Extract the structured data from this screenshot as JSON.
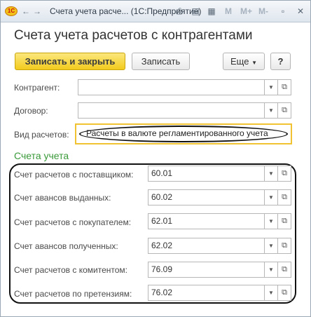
{
  "window": {
    "title": "Счета учета расче... (1С:Предприятие)",
    "logo_text": "1С",
    "toolbar_m_labels": [
      "M",
      "M+",
      "M-"
    ]
  },
  "form": {
    "title": "Счета учета расчетов с контрагентами",
    "save_close_label": "Записать и закрыть",
    "save_label": "Записать",
    "more_label": "Еще",
    "help_label": "?"
  },
  "fields": {
    "counterparty": {
      "label": "Контрагент:",
      "value": ""
    },
    "contract": {
      "label": "Договор:",
      "value": ""
    },
    "calc_type": {
      "label": "Вид расчетов:",
      "value": "Расчеты в валюте регламентированного учета"
    }
  },
  "accounts": {
    "section_title": "Счета учета",
    "rows": [
      {
        "label": "Счет расчетов с поставщиком:",
        "value": "60.01"
      },
      {
        "label": "Счет авансов выданных:",
        "value": "60.02"
      },
      {
        "label": "Счет расчетов с покупателем:",
        "value": "62.01"
      },
      {
        "label": "Счет авансов полученных:",
        "value": "62.02"
      },
      {
        "label": "Счет расчетов с комитентом:",
        "value": "76.09"
      },
      {
        "label": "Счет расчетов по претензиям:",
        "value": "76.02"
      }
    ]
  },
  "colors": {
    "primary_button": "#f3cb1e",
    "section_title": "#3a9a3a",
    "highlight_box": "#f1c231"
  }
}
